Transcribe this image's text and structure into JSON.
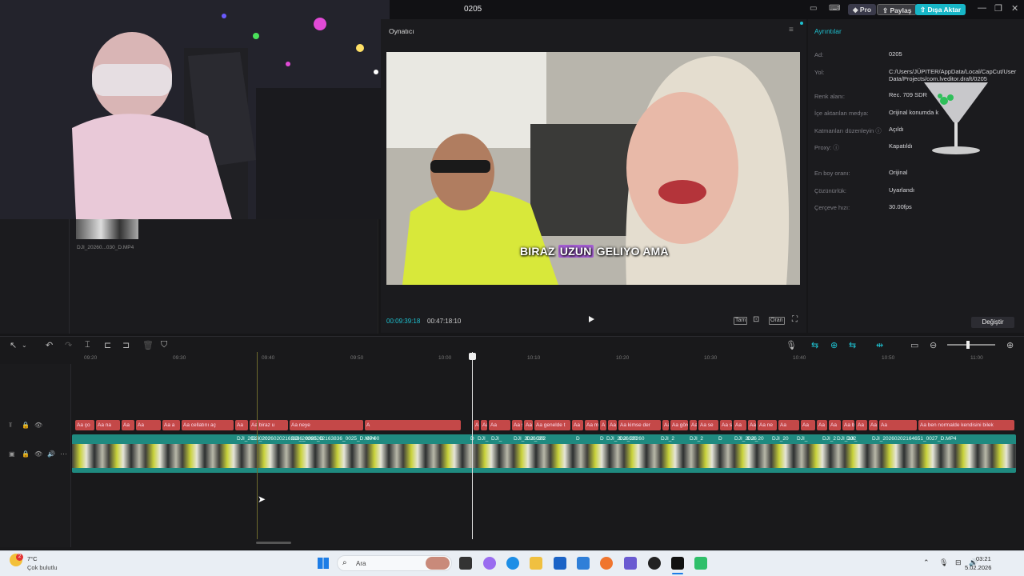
{
  "window": {
    "title": "0205",
    "pro_label": "Pro",
    "share_label": "Paylaş",
    "export_label": "Dışa Aktar"
  },
  "media": {
    "clip_name": "DJI_20260...030_D.MP4"
  },
  "player": {
    "label": "Oynatıcı",
    "subtitle_pre": "BIRAZ ",
    "subtitle_hl": "UZUN",
    "subtitle_post": " GELIYO AMA",
    "time_current": "00:09:39:18",
    "time_total": "00:47:18:10",
    "full_label": "Tam",
    "ratio_label": "Oran"
  },
  "details": {
    "title": "Ayrıntılar",
    "rows": [
      {
        "label": "Ad:",
        "value": "0205"
      },
      {
        "label": "Yol:",
        "value": "C:/Users/JÜPITER/AppData/Local/CapCut/User Data/Projects/com.lveditor.draft/0205"
      },
      {
        "label": "Renk alanı:",
        "value": "Rec. 709 SDR"
      },
      {
        "label": "İçe aktarılan medya:",
        "value": "Orijinal konumda k"
      },
      {
        "label": "Katmanları düzenleyin ⓘ",
        "value": "Açıldı"
      },
      {
        "label": "Proxy: ⓘ",
        "value": "Kapatıldı"
      },
      {
        "label": "En boy oranı:",
        "value": "Orijinal"
      },
      {
        "label": "Çözünürlük:",
        "value": "Uyarlandı"
      },
      {
        "label": "Çerçeve hızı:",
        "value": "30.00fps"
      }
    ],
    "change_label": "Değiştir"
  },
  "timeline": {
    "ticks": [
      "09:20",
      "09:30",
      "09:40",
      "09:50",
      "10:00",
      "10:10",
      "10:20",
      "10:30",
      "10:40",
      "10:50",
      "11:00"
    ],
    "text_clips": [
      "Aa ço",
      "Aa na",
      "Aa",
      "Aa",
      "Aa a",
      "Aa cellatını aç",
      "Aa",
      "Aa biraz u",
      "Aa neye",
      "A",
      "A",
      "Aa ann",
      "Aa",
      "Aa sen",
      "Aa",
      "Aa genelde t",
      "Aa",
      "Aa mak",
      "A",
      "Aa",
      "Aa kimse der",
      "Aa",
      "Aa görene",
      "Aa",
      "Aa se",
      "Aa sig",
      "Aa",
      "Aa bunu",
      "Aa ne",
      "Aa",
      "Aa",
      "Aa",
      "Aa",
      "Aa bi",
      "Aa",
      "Aa hihi",
      "Aa",
      "Aa ben normalde kendisini bilek"
    ],
    "video_labels": [
      "DJI_20260202",
      "DJI_20260202163836_0025_D",
      "DJI_20260202163836_0025_D.MP4",
      "00:00",
      "D",
      "DJI_",
      "DJI_",
      "DJI_2026020",
      "DJI_202",
      "D",
      "D",
      "DJI_2026020",
      "DJI_20260",
      "DJI_2",
      "DJI_2",
      "D",
      "DJI_2026",
      "DJI_20",
      "DJI_20",
      "DJI_",
      "DJI_2",
      "DJI_202",
      "DJI_",
      "DJI_20260202164651_0027_D.MP4"
    ]
  },
  "taskbar": {
    "temp": "7°C",
    "weather": "Çok bulutlu",
    "badge": "2",
    "search": "Ara",
    "time": "03:21",
    "date": "5.02.2026"
  }
}
